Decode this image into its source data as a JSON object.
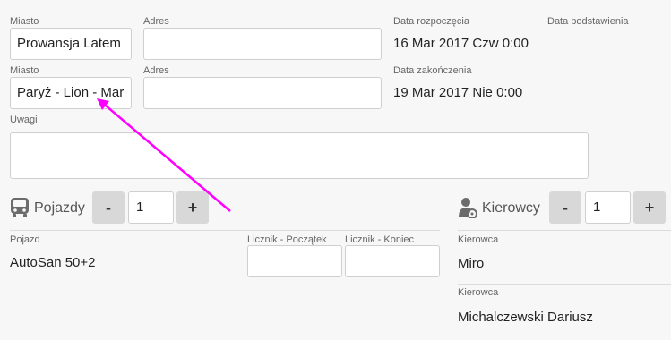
{
  "route": {
    "from": {
      "city_label": "Miasto",
      "city_value": "Prowansja Latem",
      "address_label": "Adres",
      "address_value": ""
    },
    "to": {
      "city_label": "Miasto",
      "city_value": "Paryż - Lion - Mar",
      "address_label": "Adres",
      "address_value": ""
    },
    "start_date_label": "Data rozpoczęcia",
    "start_date_value": "16 Mar 2017 Czw 0:00",
    "delivery_date_label": "Data podstawienia",
    "end_date_label": "Data zakończenia",
    "end_date_value": "19 Mar 2017 Nie 0:00"
  },
  "notes": {
    "label": "Uwagi",
    "value": ""
  },
  "vehicles": {
    "title": "Pojazdy",
    "icon": "bus-icon",
    "minus_label": "-",
    "plus_label": "+",
    "count": "1",
    "column_vehicle": "Pojazd",
    "column_counter_start": "Licznik - Początek",
    "column_counter_end": "Licznik - Koniec",
    "rows": [
      {
        "vehicle": "AutoSan 50+2",
        "counter_start": "",
        "counter_end": ""
      }
    ]
  },
  "drivers": {
    "title": "Kierowcy",
    "icon": "driver-icon",
    "minus_label": "-",
    "plus_label": "+",
    "count": "1",
    "column_driver": "Kierowca",
    "rows": [
      {
        "label": "Kierowca",
        "name": "Miro"
      },
      {
        "label": "Kierowca",
        "name": "Michalczewski Dariusz"
      }
    ]
  },
  "annotation": {
    "color": "#ff00ff"
  }
}
